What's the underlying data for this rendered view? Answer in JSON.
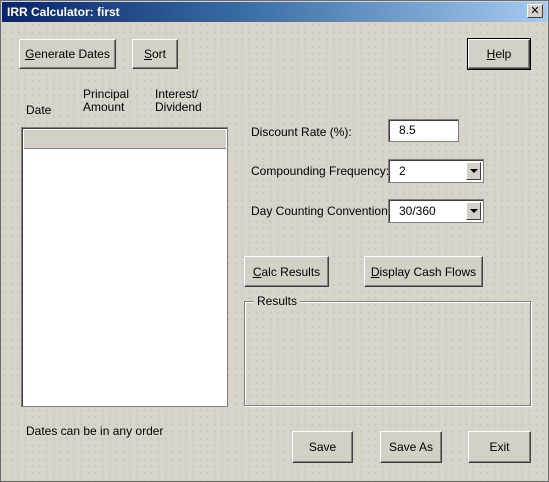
{
  "window": {
    "title": "IRR Calculator: first",
    "close_glyph": "✕"
  },
  "toolbar": {
    "generate_dates_pre": "",
    "generate_dates_u": "G",
    "generate_dates_post": "enerate Dates",
    "sort_pre": "",
    "sort_u": "S",
    "sort_post": "ort",
    "help_pre": "",
    "help_u": "H",
    "help_post": "elp"
  },
  "list": {
    "col_date": "Date",
    "col_principal_1": "Principal",
    "col_principal_2": "Amount",
    "col_interest_1": "Interest/",
    "col_interest_2": "Dividend"
  },
  "form": {
    "discount_label": "Discount Rate (%):",
    "discount_value": "8.5",
    "compounding_label": "Compounding Frequency:",
    "compounding_value": "2",
    "daycount_label": "Day Counting Convention:",
    "daycount_value": "30/360"
  },
  "actions": {
    "calc_pre": "",
    "calc_u": "C",
    "calc_post": "alc Results",
    "display_pre": "",
    "display_u": "D",
    "display_post": "isplay Cash Flows"
  },
  "results": {
    "title": "Results"
  },
  "footer": {
    "note": "Dates can be in any order",
    "save": "Save",
    "save_as": "Save As",
    "exit": "Exit"
  }
}
